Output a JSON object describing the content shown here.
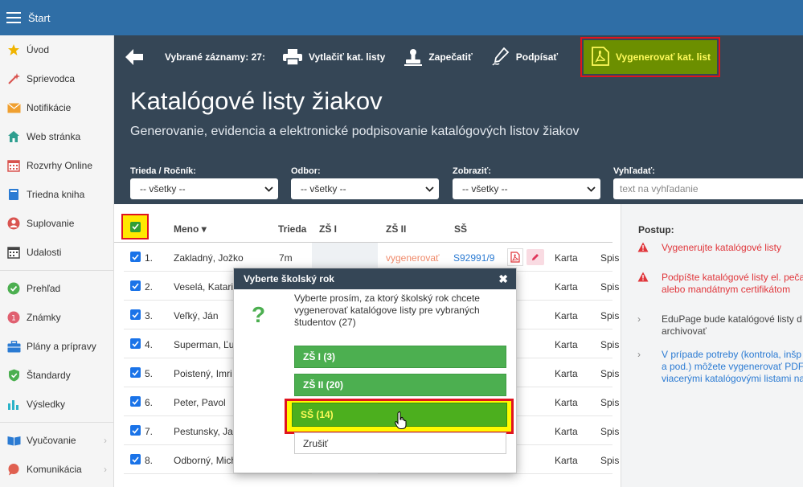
{
  "app": {
    "title": "Štart"
  },
  "sidebar": {
    "items": [
      {
        "label": "Úvod",
        "icon": "star-icon",
        "color": "#f0b400"
      },
      {
        "label": "Sprievodca",
        "icon": "wand-icon",
        "color": "#d9534f"
      },
      {
        "label": "Notifikácie",
        "icon": "envelope-icon",
        "color": "#f0a030"
      },
      {
        "label": "Web stránka",
        "icon": "house-icon",
        "color": "#2e9e8f"
      },
      {
        "label": "Rozvrhy Online",
        "icon": "timetable-icon",
        "color": "#d9534f"
      },
      {
        "label": "Triedna kniha",
        "icon": "book-icon",
        "color": "#2b7bd3"
      },
      {
        "label": "Suplovanie",
        "icon": "person-icon",
        "color": "#d9534f"
      },
      {
        "label": "Udalosti",
        "icon": "calendar-icon",
        "color": "#555555"
      }
    ],
    "items2": [
      {
        "label": "Prehľad",
        "icon": "check-circle-icon",
        "color": "#4caf50"
      },
      {
        "label": "Známky",
        "icon": "grade-icon",
        "color": "#e06070"
      },
      {
        "label": "Plány a prípravy",
        "icon": "briefcase-icon",
        "color": "#2b7bd3"
      },
      {
        "label": "Štandardy",
        "icon": "shield-icon",
        "color": "#4caf50"
      },
      {
        "label": "Výsledky",
        "icon": "bar-chart-icon",
        "color": "#2bb3c8"
      }
    ],
    "items3": [
      {
        "label": "Vyučovanie",
        "icon": "open-book-icon",
        "color": "#2b7bd3"
      },
      {
        "label": "Komunikácia",
        "icon": "chat-icon",
        "color": "#e06050"
      }
    ]
  },
  "toolbar": {
    "selected": "Vybrané záznamy: 27:",
    "print": "Vytlačiť kat. listy",
    "seal": "Zapečatiť",
    "sign": "Podpísať",
    "generate": "Vygenerovať kat. list",
    "generate_color": "#6c8f00"
  },
  "header": {
    "title": "Katalógové listy žiakov",
    "subtitle": "Generovanie, evidencia a elektronické podpisovanie katalógových listov žiakov"
  },
  "filters": {
    "trieda_label": "Trieda / Ročník:",
    "trieda_value": "-- všetky --",
    "odbor_label": "Odbor:",
    "odbor_value": "-- všetky --",
    "zobrazit_label": "Zobraziť:",
    "zobrazit_value": "-- všetky --",
    "search_label": "Vyhľadať:",
    "search_placeholder": "text na vyhľadanie"
  },
  "table": {
    "headers": {
      "meno": "Meno",
      "trieda": "Trieda",
      "zs1": "ZŠ I",
      "zs2": "ZŠ II",
      "ss": "SŠ"
    },
    "rows": [
      {
        "num": "1.",
        "meno": "Zakladný, Jožko",
        "trieda": "7m",
        "gen": "vygenerovať",
        "ss": "S92991/9",
        "karta": "Karta",
        "spis": "Spis"
      },
      {
        "num": "2.",
        "meno": "Veselá, Katari",
        "trieda": "",
        "gen": "",
        "ss": "",
        "karta": "Karta",
        "spis": "Spis"
      },
      {
        "num": "3.",
        "meno": "Veľký, Ján",
        "trieda": "",
        "gen": "",
        "ss": "",
        "karta": "Karta",
        "spis": "Spis"
      },
      {
        "num": "4.",
        "meno": "Superman, Ľu",
        "trieda": "",
        "gen": "",
        "ss": "",
        "karta": "Karta",
        "spis": "Spis"
      },
      {
        "num": "5.",
        "meno": "Poistený, Imri",
        "trieda": "",
        "gen": "",
        "ss": "",
        "karta": "Karta",
        "spis": "Spis"
      },
      {
        "num": "6.",
        "meno": "Peter, Pavol",
        "trieda": "",
        "gen": "",
        "ss": "",
        "karta": "Karta",
        "spis": "Spis"
      },
      {
        "num": "7.",
        "meno": "Pestunsky, Ja",
        "trieda": "",
        "gen": "",
        "ss": "",
        "karta": "Karta",
        "spis": "Spis"
      },
      {
        "num": "8.",
        "meno": "Odborný, Mich",
        "trieda": "",
        "gen": "",
        "ss": "",
        "karta": "Karta",
        "spis": "Spis"
      }
    ]
  },
  "right_panel": {
    "title": "Postup:",
    "steps": [
      "Vygenerujte katalógové listy",
      "Podpíšte katalógové listy el. peča alebo mandátnym certifikátom",
      "EduPage bude katalógové listy d archivovať",
      "V prípade potreby (kontrola, inšp a pod.) môžete vygenerovať PDF viacerými katalógovými listami na"
    ]
  },
  "modal": {
    "title": "Vyberte školský rok",
    "text": "Vyberte prosím, za ktorý školský rok chcete vygenerovať katalógove listy pre vybraných študentov (27)",
    "options": [
      "ZŠ I (3)",
      "ZŠ II (20)",
      "SŠ (14)"
    ],
    "cancel": "Zrušiť"
  }
}
